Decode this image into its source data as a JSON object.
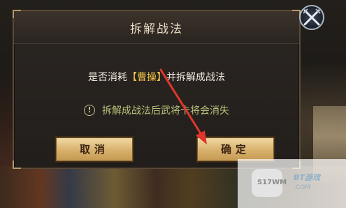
{
  "dialog": {
    "title": "拆解战法",
    "question_prefix": "是否消耗",
    "question_highlight": "【曹操】",
    "question_suffix": "并拆解成战法",
    "warning_text": "拆解成战法后武将卡将会消失",
    "cancel_label": "取消",
    "confirm_label": "确定"
  },
  "icons": {
    "warning": "exclamation-circle-icon",
    "close": "crossed-swords-close-icon",
    "annotation": "red-arrow-annotation"
  },
  "watermark": {
    "site_left": "S17WM",
    "site_left_domain": ".COM",
    "site_right": "BT游戏"
  },
  "colors": {
    "highlight": "#f5c64a",
    "warning_text": "#b9c27a",
    "button_gold": "#d7b06b",
    "annotation_red": "#e0352b"
  }
}
